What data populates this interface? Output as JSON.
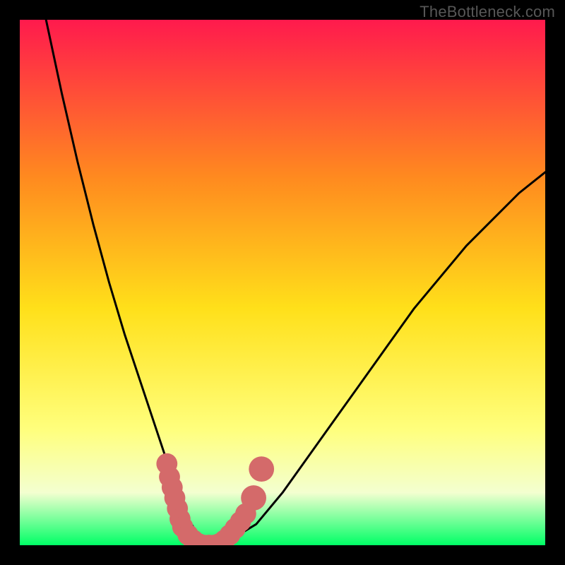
{
  "watermark": "TheBottleneck.com",
  "colors": {
    "frame": "#000000",
    "gradient_top": "#ff1a4d",
    "gradient_upper_mid": "#ff8a1f",
    "gradient_mid": "#ffe01a",
    "gradient_lower_mid": "#ffff7d",
    "gradient_lower": "#f3ffd0",
    "gradient_bottom": "#00ff66",
    "curve": "#000000",
    "markers": "#d46a6a"
  },
  "chart_data": {
    "type": "line",
    "title": "",
    "xlabel": "",
    "ylabel": "",
    "xlim": [
      0,
      100
    ],
    "ylim": [
      0,
      100
    ],
    "series": [
      {
        "name": "bottleneck-curve",
        "x": [
          5,
          8,
          11,
          14,
          17,
          20,
          23,
          26,
          28,
          30,
          32,
          34,
          36,
          38,
          40,
          45,
          50,
          55,
          60,
          65,
          70,
          75,
          80,
          85,
          90,
          95,
          100
        ],
        "values": [
          100,
          86,
          73,
          61,
          50,
          40,
          31,
          22,
          16,
          10,
          5,
          2,
          0,
          0,
          1,
          4,
          10,
          17,
          24,
          31,
          38,
          45,
          51,
          57,
          62,
          67,
          71
        ]
      }
    ],
    "markers": [
      {
        "x": 28.0,
        "y": 15.5,
        "r": 1.2
      },
      {
        "x": 28.5,
        "y": 13.0,
        "r": 1.2
      },
      {
        "x": 29.0,
        "y": 11.0,
        "r": 1.2
      },
      {
        "x": 29.5,
        "y": 9.0,
        "r": 1.2
      },
      {
        "x": 30.0,
        "y": 7.0,
        "r": 1.2
      },
      {
        "x": 30.5,
        "y": 5.0,
        "r": 1.2
      },
      {
        "x": 31.0,
        "y": 3.5,
        "r": 1.2
      },
      {
        "x": 32.0,
        "y": 2.0,
        "r": 1.2
      },
      {
        "x": 33.0,
        "y": 1.0,
        "r": 1.2
      },
      {
        "x": 34.0,
        "y": 0.3,
        "r": 1.2
      },
      {
        "x": 35.0,
        "y": 0.0,
        "r": 1.2
      },
      {
        "x": 36.0,
        "y": 0.0,
        "r": 1.2
      },
      {
        "x": 37.0,
        "y": 0.0,
        "r": 1.2
      },
      {
        "x": 38.0,
        "y": 0.3,
        "r": 1.2
      },
      {
        "x": 39.0,
        "y": 1.0,
        "r": 1.2
      },
      {
        "x": 40.0,
        "y": 2.0,
        "r": 1.2
      },
      {
        "x": 41.0,
        "y": 3.2,
        "r": 1.2
      },
      {
        "x": 42.0,
        "y": 4.5,
        "r": 1.2
      },
      {
        "x": 43.0,
        "y": 6.0,
        "r": 1.2
      },
      {
        "x": 44.5,
        "y": 9.0,
        "r": 1.6
      },
      {
        "x": 46.0,
        "y": 14.5,
        "r": 1.6
      }
    ]
  }
}
